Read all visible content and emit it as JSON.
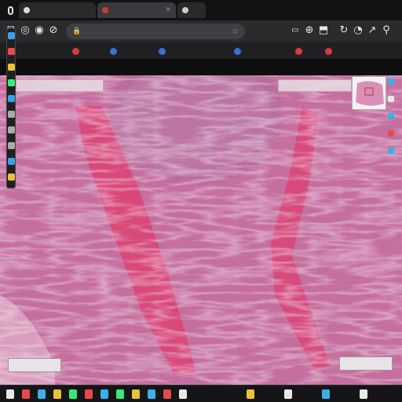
{
  "browser": {
    "tabs": [
      {
        "title": "",
        "favicon_color": "#d9d9d9",
        "active": false
      },
      {
        "title": "",
        "favicon_color": "#d03a3a",
        "active": true
      },
      {
        "title": "",
        "favicon_color": "#cccccc",
        "active": false
      }
    ],
    "address_url": "",
    "toolbar_icons": [
      "back-icon",
      "forward-icon",
      "reload-icon",
      "home-icon",
      "star-icon",
      "extension-icon",
      "puzzle-icon",
      "profile-icon",
      "menu-icon"
    ],
    "bookmarks": [
      {
        "label": "",
        "color": "#d33c3c"
      },
      {
        "label": "",
        "color": "#3b6fd8"
      },
      {
        "label": "",
        "color": "#3b6fd8"
      },
      {
        "label": "",
        "color": "#3b6fd8"
      },
      {
        "label": "",
        "color": "#d33c3c"
      },
      {
        "label": "",
        "color": "#d33c3c"
      }
    ]
  },
  "viewer": {
    "title": "",
    "top_left_label": "",
    "top_right_label": "",
    "scale_left": "",
    "scale_right": "",
    "left_tool_colors": [
      "#3aa0e8",
      "#e84a4a",
      "#e8c33a",
      "#3ae87a",
      "#3aa0e8",
      "#aaaaaa",
      "#aaaaaa",
      "#aaaaaa",
      "#3aa0e8",
      "#e8c33a"
    ],
    "right_tool_colors": [
      "#3ab0e8",
      "#e8e8e8",
      "#3ab0e8",
      "#e84a4a",
      "#3ab0e8"
    ]
  },
  "colors": {
    "tissue_base": "#c86c9a",
    "stroma_band": "#e03b6a",
    "nuclei": "#6b3f8a",
    "pale_region": "#b86a98"
  },
  "taskbar_colors": [
    "#e8e8e8",
    "#e84a4a",
    "#3ab0e8",
    "#e8c33a",
    "#3ae87a",
    "#e84a4a",
    "#3ab0e8",
    "#3ae87a",
    "#e8c33a",
    "#3ab0e8",
    "#e84a4a",
    "#e8e8e8"
  ]
}
